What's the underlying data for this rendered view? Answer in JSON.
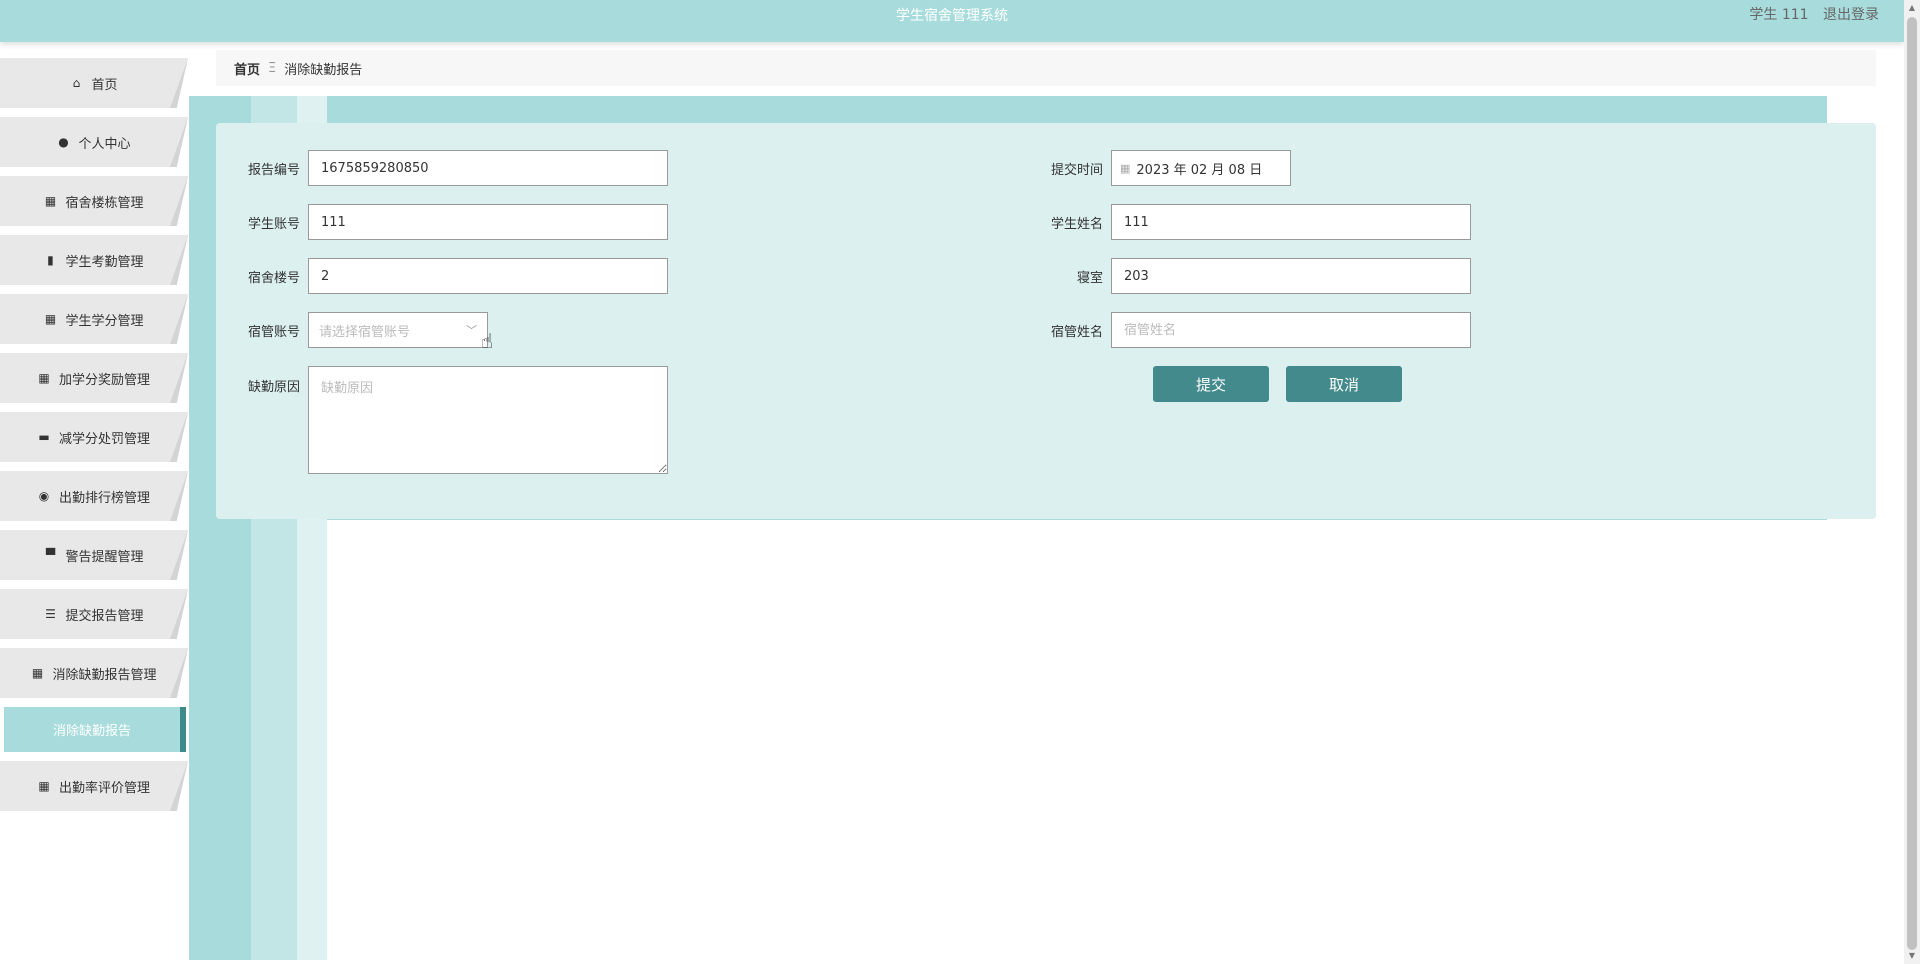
{
  "header": {
    "app_title": "学生宿舍管理系统",
    "user_label": "学生 111",
    "logout_label": "退出登录"
  },
  "sidebar": {
    "items": [
      {
        "label": "首页",
        "icon": "home-icon"
      },
      {
        "label": "个人中心",
        "icon": "user-icon"
      },
      {
        "label": "宿舍楼栋管理",
        "icon": "grid-icon"
      },
      {
        "label": "学生考勤管理",
        "icon": "book-icon"
      },
      {
        "label": "学生学分管理",
        "icon": "grid-icon"
      },
      {
        "label": "加学分奖励管理",
        "icon": "grid-icon"
      },
      {
        "label": "减学分处罚管理",
        "icon": "briefcase-icon"
      },
      {
        "label": "出勤排行榜管理",
        "icon": "pin-icon"
      },
      {
        "label": "警告提醒管理",
        "icon": "printer-icon"
      },
      {
        "label": "提交报告管理",
        "icon": "sliders-icon"
      },
      {
        "label": "消除缺勤报告管理",
        "icon": "grid-icon"
      },
      {
        "label": "出勤率评价管理",
        "icon": "grid-icon"
      }
    ],
    "active_sub_item": "消除缺勤报告"
  },
  "breadcrumb": {
    "home": "首页",
    "separator": "Ξ",
    "current": "消除缺勤报告"
  },
  "form": {
    "report_no": {
      "label": "报告编号",
      "value": "1675859280850"
    },
    "submit_time": {
      "label": "提交时间",
      "value": "2023 年 02 月 08 日"
    },
    "student_account": {
      "label": "学生账号",
      "value": "111"
    },
    "student_name": {
      "label": "学生姓名",
      "value": "111"
    },
    "building_no": {
      "label": "宿舍楼号",
      "value": "2"
    },
    "room": {
      "label": "寝室",
      "value": "203"
    },
    "manager_account": {
      "label": "宿管账号",
      "placeholder": "请选择宿管账号"
    },
    "manager_name": {
      "label": "宿管姓名",
      "placeholder": "宿管姓名"
    },
    "absence_reason": {
      "label": "缺勤原因",
      "placeholder": "缺勤原因"
    },
    "submit_label": "提交",
    "cancel_label": "取消"
  },
  "colors": {
    "accent": "#a8dcdc",
    "button": "#428a8c",
    "panel": "#dcf0f0"
  }
}
